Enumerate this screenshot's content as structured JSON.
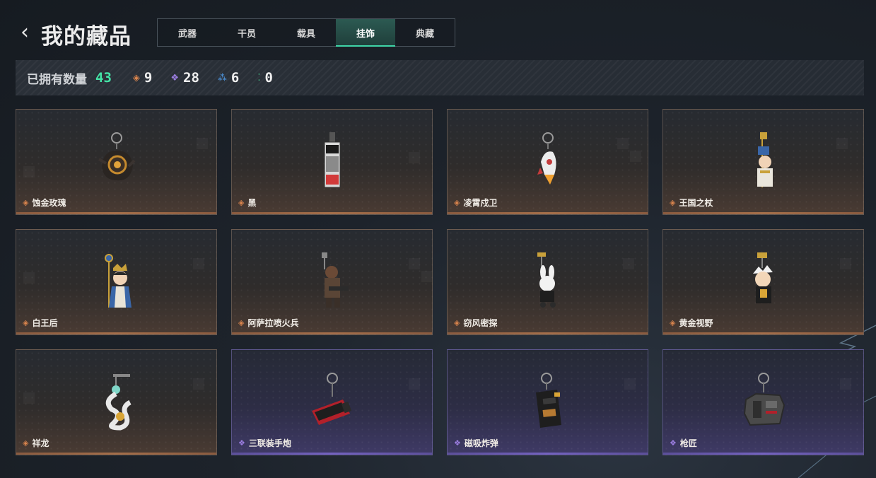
{
  "header": {
    "title": "我的藏品",
    "back_icon": "chevron-left-icon"
  },
  "tabs": [
    {
      "label": "武器",
      "active": false
    },
    {
      "label": "干员",
      "active": false
    },
    {
      "label": "载具",
      "active": false
    },
    {
      "label": "挂饰",
      "active": true
    },
    {
      "label": "典藏",
      "active": false
    }
  ],
  "accent_color": "#3fd5a8",
  "stats": {
    "owned_label": "已拥有数量",
    "owned_count": "43",
    "rarities": [
      {
        "icon": "orange-diamond-icon",
        "glyph": "◈",
        "color": "#d9844d",
        "count": "9"
      },
      {
        "icon": "purple-diamond-icon",
        "glyph": "❖",
        "color": "#9b7de0",
        "count": "28"
      },
      {
        "icon": "blue-diamond-icon",
        "glyph": "⁂",
        "color": "#4f97e0",
        "count": "6"
      },
      {
        "icon": "green-diamond-icon",
        "glyph": "⁚",
        "color": "#49c98e",
        "count": "0"
      }
    ]
  },
  "rarity_colors": {
    "orange": "#d9844d",
    "purple": "#9b7de0"
  },
  "items": [
    {
      "name": "蚀金玫瑰",
      "rarity": "orange",
      "icon": "rose-charm-icon"
    },
    {
      "name": "黑",
      "rarity": "orange",
      "icon": "card-tag-charm-icon"
    },
    {
      "name": "凌霄戍卫",
      "rarity": "orange",
      "icon": "rocket-charm-icon"
    },
    {
      "name": "王国之杖",
      "rarity": "orange",
      "icon": "king-figure-charm-icon"
    },
    {
      "name": "白王后",
      "rarity": "orange",
      "icon": "queen-figure-charm-icon"
    },
    {
      "name": "阿萨拉喷火兵",
      "rarity": "orange",
      "icon": "flamethrower-soldier-charm-icon"
    },
    {
      "name": "窃风密探",
      "rarity": "orange",
      "icon": "rabbit-spy-charm-icon"
    },
    {
      "name": "黄金视野",
      "rarity": "orange",
      "icon": "golden-figure-charm-icon"
    },
    {
      "name": "祥龙",
      "rarity": "orange",
      "icon": "dragon-charm-icon"
    },
    {
      "name": "三联装手炮",
      "rarity": "purple",
      "icon": "hand-cannon-charm-icon"
    },
    {
      "name": "磁吸炸弹",
      "rarity": "purple",
      "icon": "magnetic-bomb-charm-icon"
    },
    {
      "name": "枪匠",
      "rarity": "purple",
      "icon": "gunsmith-box-charm-icon"
    }
  ]
}
